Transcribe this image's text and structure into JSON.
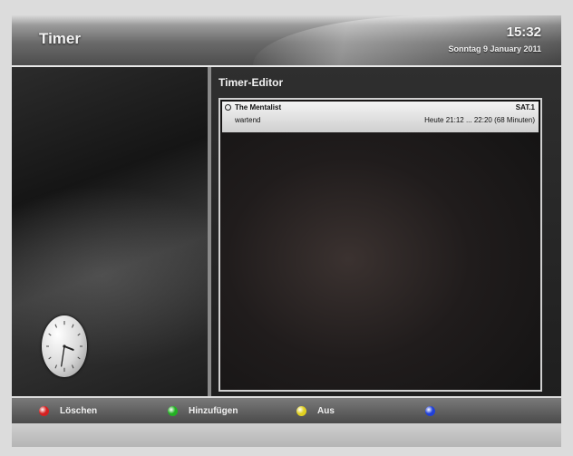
{
  "header": {
    "title": "Timer",
    "time": "15:32",
    "date": "Sonntag 9 January 2011"
  },
  "editor": {
    "title": "Timer-Editor",
    "entries": [
      {
        "name": "The Mentalist",
        "channel": "SAT.1",
        "status": "wartend",
        "time": "Heute 21:12 ... 22:20 (68 Minuten)"
      }
    ]
  },
  "clock": {
    "hour": 3,
    "minute": 32
  },
  "footer": {
    "keys": [
      {
        "label": "Löschen",
        "color": "#d42020"
      },
      {
        "label": "Hinzufügen",
        "color": "#22b022"
      },
      {
        "label": "Aus",
        "color": "#e0d020"
      },
      {
        "label": "",
        "color": "#2040d8"
      }
    ]
  }
}
